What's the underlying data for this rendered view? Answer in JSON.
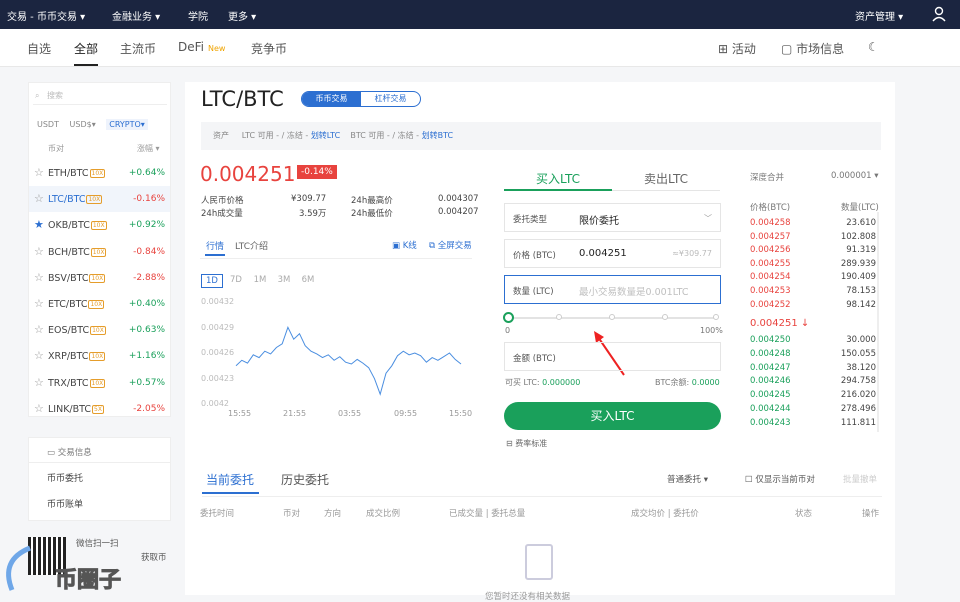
{
  "topnav": {
    "trade": "交易 - 币币交易 ▾",
    "finance": "金融业务 ▾",
    "academy": "学院",
    "more": "更多 ▾",
    "assets": "资产管理 ▾"
  },
  "subnav": {
    "tabs": [
      "自选",
      "全部",
      "主流币",
      "DeFi",
      "竞争币"
    ],
    "new_badge": "New",
    "activity": "活动",
    "market_info": "市场信息"
  },
  "left": {
    "search_placeholder": "搜索",
    "quotes": [
      "USDT",
      "USD$▾",
      "CRYPTO▾"
    ],
    "col_pair": "币对",
    "col_change": "涨幅 ▾",
    "rows": [
      {
        "star": "☆",
        "pair": "ETH/BTC",
        "lev": "10X",
        "change": "+0.64%",
        "dir": "up"
      },
      {
        "star": "☆",
        "pair": "LTC/BTC",
        "lev": "10X",
        "change": "-0.16%",
        "dir": "dn"
      },
      {
        "star": "★",
        "pair": "OKB/BTC",
        "lev": "10X",
        "change": "+0.92%",
        "dir": "up"
      },
      {
        "star": "☆",
        "pair": "BCH/BTC",
        "lev": "10X",
        "change": "-0.84%",
        "dir": "dn"
      },
      {
        "star": "☆",
        "pair": "BSV/BTC",
        "lev": "10X",
        "change": "-2.88%",
        "dir": "dn"
      },
      {
        "star": "☆",
        "pair": "ETC/BTC",
        "lev": "10X",
        "change": "+0.40%",
        "dir": "up"
      },
      {
        "star": "☆",
        "pair": "EOS/BTC",
        "lev": "10X",
        "change": "+0.63%",
        "dir": "up"
      },
      {
        "star": "☆",
        "pair": "XRP/BTC",
        "lev": "10X",
        "change": "+1.16%",
        "dir": "up"
      },
      {
        "star": "☆",
        "pair": "TRX/BTC",
        "lev": "10X",
        "change": "+0.57%",
        "dir": "up"
      },
      {
        "star": "☆",
        "pair": "LINK/BTC",
        "lev": "5X",
        "change": "-2.05%",
        "dir": "dn"
      }
    ]
  },
  "info": {
    "title": "交易信息",
    "orders": "币币委托",
    "bills": "币币账单",
    "wechat": "微信扫一扫",
    "get": "获取币",
    "watermark": "币圈子"
  },
  "main": {
    "pair": "LTC/BTC",
    "mode_spot": "币币交易",
    "mode_margin": "杠杆交易",
    "assets_line": {
      "label": "资产",
      "ltc": "LTC  可用 - / 冻结 -",
      "ltc_link": "划转LTC",
      "btc": "BTC  可用 - / 冻结 -",
      "btc_link": "划转BTC"
    },
    "price": "0.004251",
    "pct": "-0.14%",
    "stats": {
      "cny_label": "人民币价格",
      "cny": "¥309.77",
      "high_label": "24h最高价",
      "high": "0.004307",
      "vol_label": "24h成交量",
      "vol": "3.59万",
      "low_label": "24h最低价",
      "low": "0.004207"
    },
    "chart_tabs": {
      "quote": "行情",
      "intro": "LTC介绍",
      "kline": "K线",
      "fullscreen": "全屏交易"
    },
    "ranges": [
      "1D",
      "7D",
      "1M",
      "3M",
      "6M"
    ]
  },
  "chart_data": {
    "type": "line",
    "yticks": [
      "0.00432",
      "0.00429",
      "0.00426",
      "0.00423",
      "0.0042"
    ],
    "xticks": [
      "15:55",
      "21:55",
      "03:55",
      "09:55",
      "15:50"
    ],
    "ylim": [
      0.0042,
      0.00432
    ],
    "values": [
      0.004246,
      0.004252,
      0.004249,
      0.004258,
      0.004255,
      0.004262,
      0.004259,
      0.004266,
      0.00427,
      0.004288,
      0.004275,
      0.004281,
      0.004268,
      0.004262,
      0.004259,
      0.004255,
      0.004258,
      0.004252,
      0.004256,
      0.00425,
      0.004248,
      0.004253,
      0.004249,
      0.004244,
      0.004232,
      0.004215,
      0.004238,
      0.004246,
      0.004257,
      0.004262,
      0.004258,
      0.00426,
      0.004257,
      0.00425,
      0.004255,
      0.004252,
      0.004256,
      0.00426,
      0.004253,
      0.004248
    ]
  },
  "order": {
    "buy_tab": "买入LTC",
    "sell_tab": "卖出LTC",
    "type_label": "委托类型",
    "type_value": "限价委托",
    "price_label": "价格 (BTC)",
    "price_value": "0.004251",
    "price_hint": "≈¥309.77",
    "qty_label": "数量 (LTC)",
    "qty_placeholder": "最小交易数量是0.001LTC",
    "pct_min": "0",
    "pct_max": "100%",
    "amount_label": "金额 (BTC)",
    "avail_ltc": "可买 LTC:",
    "avail_ltc_val": "0.000000",
    "btc_bal": "BTC余额:",
    "btc_bal_val": "0.0000",
    "buy_btn": "买入LTC",
    "fee": "费率标准"
  },
  "orderbook": {
    "depth_label": "深度合并",
    "depth_value": "0.000001 ▾",
    "col_price": "价格(BTC)",
    "col_qty": "数量(LTC)",
    "mid": "0.004251 ↓",
    "asks": [
      [
        "0.004258",
        "23.610"
      ],
      [
        "0.004257",
        "102.808"
      ],
      [
        "0.004256",
        "91.319"
      ],
      [
        "0.004255",
        "289.939"
      ],
      [
        "0.004254",
        "190.409"
      ],
      [
        "0.004253",
        "78.153"
      ],
      [
        "0.004252",
        "98.142"
      ]
    ],
    "bids": [
      [
        "0.004250",
        "30.000"
      ],
      [
        "0.004248",
        "150.055"
      ],
      [
        "0.004247",
        "38.120"
      ],
      [
        "0.004246",
        "294.758"
      ],
      [
        "0.004245",
        "216.020"
      ],
      [
        "0.004244",
        "278.496"
      ],
      [
        "0.004243",
        "111.811"
      ]
    ]
  },
  "bottom": {
    "current": "当前委托",
    "history": "历史委托",
    "filter": "普通委托 ▾",
    "only_current": "仅显示当前币对",
    "cancel_all": "批量撤单",
    "headers": [
      "委托时间",
      "币对",
      "方向",
      "成交比例",
      "已成交量 | 委托总量",
      "成交均价 | 委托价",
      "状态",
      "操作"
    ],
    "empty": "您暂时还没有相关数据"
  },
  "colors": {
    "up": "#1aa05b",
    "down": "#e8433e",
    "accent": "#2c6fd1",
    "nav": "#1b2540"
  }
}
